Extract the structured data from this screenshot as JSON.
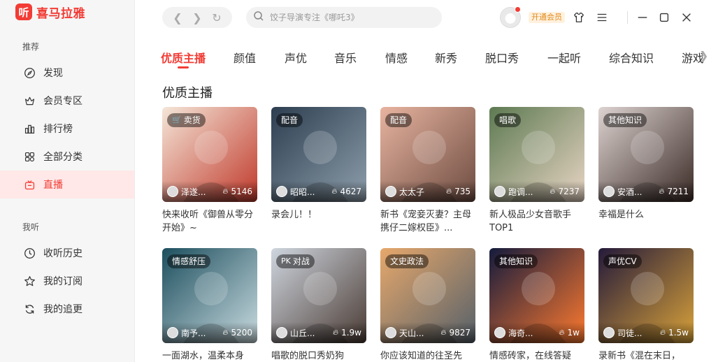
{
  "app": {
    "logo_char": "听",
    "name": "喜马拉雅"
  },
  "sidebar": {
    "section1": "推荐",
    "section2": "我听",
    "items": [
      {
        "label": "发现",
        "icon": "compass-icon"
      },
      {
        "label": "会员专区",
        "icon": "crown-icon"
      },
      {
        "label": "排行榜",
        "icon": "ranking-icon"
      },
      {
        "label": "全部分类",
        "icon": "grid-icon"
      },
      {
        "label": "直播",
        "icon": "tv-icon",
        "active": true
      },
      {
        "label": "收听历史",
        "icon": "clock-icon"
      },
      {
        "label": "我的订阅",
        "icon": "star-icon"
      },
      {
        "label": "我的追更",
        "icon": "refresh-icon"
      }
    ]
  },
  "topbar": {
    "search_placeholder": "饺子导演专注《哪吒3》",
    "vip_label": "开通会员"
  },
  "tabs": [
    "优质主播",
    "颜值",
    "声优",
    "音乐",
    "情感",
    "新秀",
    "脱口秀",
    "一起听",
    "综合知识",
    "游戏"
  ],
  "section_title": "优质主播",
  "cards": [
    {
      "badge": "卖货",
      "badge_icon": "cart-icon",
      "host": "泽遂...",
      "count": "5146",
      "desc": "快来收听《御兽从零分开始》~",
      "colors": [
        "#f4e6d8",
        "#c0392b"
      ]
    },
    {
      "badge": "配音",
      "host": "昭昭...",
      "count": "4627",
      "desc": "录会儿！！",
      "colors": [
        "#2c3e50",
        "#8e9eab"
      ]
    },
    {
      "badge": "配音",
      "host": "太太子",
      "count": "735",
      "desc": "新书《宠妾灭妻？主母携仔二嫁权臣》...",
      "colors": [
        "#e8b4a0",
        "#6d4c41"
      ]
    },
    {
      "badge": "唱歌",
      "host": "跑调...",
      "count": "7237",
      "desc": "新人极品少女音歌手TOP1",
      "colors": [
        "#5d7a52",
        "#e8d5c4"
      ]
    },
    {
      "badge": "其他知识",
      "host": "安酒...",
      "count": "7211",
      "desc": "幸福是什么",
      "colors": [
        "#ddd3d0",
        "#3a2a26"
      ]
    },
    {
      "badge": "情感舒压",
      "host": "南予...",
      "count": "5200",
      "desc": "一面湖水，温柔本身",
      "colors": [
        "#1d4f5e",
        "#c9dbe0"
      ]
    },
    {
      "badge": "对战",
      "badge_icon": "pk-icon",
      "host": "山丘...",
      "count": "1.9w",
      "desc": "唱歌的脱口秀奶狗",
      "colors": [
        "#cfd6df",
        "#4a3b34"
      ]
    },
    {
      "badge": "文史政法",
      "host": "天山...",
      "count": "9827",
      "desc": "你应该知道的往圣先",
      "colors": [
        "#e7a86b",
        "#55606a"
      ]
    },
    {
      "badge": "其他知识",
      "host": "海奇...",
      "count": "1w",
      "desc": "情感砖家，在线答疑",
      "colors": [
        "#141b3d",
        "#ff7a2f"
      ]
    },
    {
      "badge": "声优CV",
      "host": "司徒...",
      "count": "1.5w",
      "desc": "录新书《混在末日，",
      "colors": [
        "#241a3a",
        "#d9a23a"
      ]
    }
  ]
}
